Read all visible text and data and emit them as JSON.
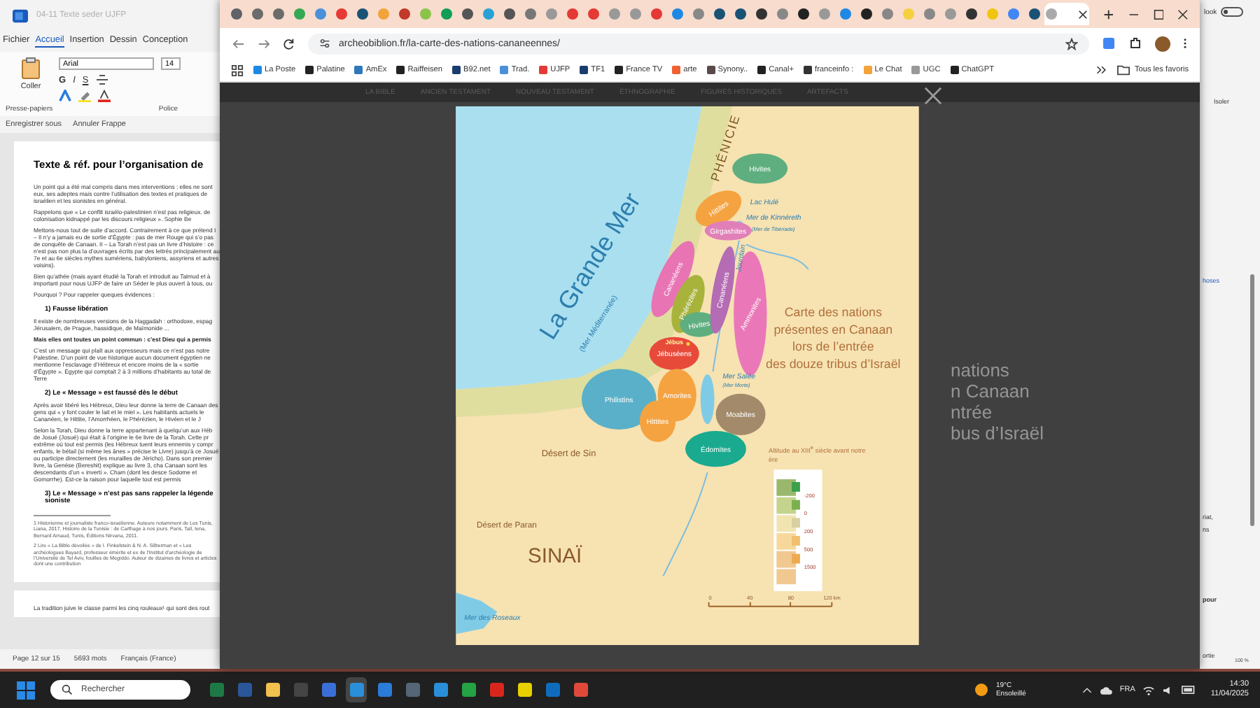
{
  "word": {
    "doc_name": "04-11 Texte seder UJFP",
    "menu": [
      {
        "label": "Fichier",
        "selected": false
      },
      {
        "label": "Accueil",
        "selected": true
      },
      {
        "label": "Insertion",
        "selected": false
      },
      {
        "label": "Dessin",
        "selected": false
      },
      {
        "label": "Conception",
        "selected": false
      }
    ],
    "paste": "Coller",
    "font": "Arial",
    "size": "14",
    "format_buttons": [
      "G",
      "I",
      "S"
    ],
    "groups": [
      "Presse-papiers",
      "Police"
    ],
    "quick": [
      "Enregistrer sous",
      "Annuler Frappe"
    ],
    "blocks": [
      {
        "kind": "title",
        "text": "Texte & réf. pour l’organisation de"
      },
      {
        "kind": "para",
        "text": "Un point qui a été mal compris dans mes interventions : elles ne sont eux, ses adeptes mais contre l’utilisation des textes et pratiques de israélien et les sionistes en général."
      },
      {
        "kind": "para",
        "text": "Rappelons que « Le conflit israélo-palestinien n’est pas religieux. de colonisation kidnappé par les discours religieux ». Sophie Be"
      },
      {
        "kind": "para",
        "text": "Mettons-nous tout de suite d’accord. Contrairement à ce que prétend I – Il n’y a jamais eu de sortie d’Égypte : pas de mer Rouge qui s’o pas de conquête de Canaan. II – La Torah n’est pas un livre d’histoire : ce n’est pas non plus la d’ouvrages écrits par des lettrés principalement au 7e et au 6e siècles mythes sumériens, babyloniens, assyriens et autres voisins)."
      },
      {
        "kind": "para",
        "text": "Bien qu’athée (mais ayant étudié la Torah et introduit au Talmud et à important pour nous UJFP de faire un Séder le plus ouvert à tous, ou"
      },
      {
        "kind": "para",
        "text": "Pourquoi ? Pour rappeler queques évidences :"
      },
      {
        "kind": "heading",
        "text": "1) Fausse libération"
      },
      {
        "kind": "para",
        "text": "Il existe de nombreuses versions de la Haggadah : orthodoxe, espag Jérusalem, de Prague, hassidique, de Maïmonide ..."
      },
      {
        "kind": "strong",
        "text": "Mais elles ont toutes un point commun : c’est Dieu qui a permis"
      },
      {
        "kind": "para",
        "text": "C’est un message qui plaît aux oppresseurs mais ce n’est pas notre Palestine. D’un point de vue historique aucun document égyptien ne mentionne l’esclavage d’Hébreux et encore moins de la « sortie d’Égypte ». Egypte qui comptait 2 à 3 millions d’habitants au total de Terre"
      },
      {
        "kind": "heading",
        "text": "2) Le « Message » est faussé dès le début"
      },
      {
        "kind": "para",
        "text": "Après avoir libéré les Hébreux, Dieu leur donne la terre de Canaan des gens qui « y font couler le lait et le miel ». Les habitants actuels le Cananéen, le Hittite, l’Amorrhéen, le Phérézien, le Hivéen et le J"
      },
      {
        "kind": "para",
        "text": "Selon la Torah, Dieu donne la terre appartenant à quelqu’un aux Héb de Josué (Josué) qui était à l’origine le 6e livre de la Torah. Cette pr extrême où tout est permis (les Hébreux tuent leurs ennemis y compr enfants, le bétail (si même les ânes » précise le Livre) jusqu’à ce Josué ou participe directement (les murailles de Jéricho). Dans son premier livre, la Genèse (Bereshit) explique au livre 3, cha Canaan sont les descendants d’un « inverti ». Cham (dont les desce Sodome et Gomorrhe). Est-ce la raison pour laquelle tout est permis"
      },
      {
        "kind": "heading",
        "text": "3) Le « Message » n’est pas sans rappeler la légende sioniste"
      },
      {
        "kind": "rule"
      },
      {
        "kind": "note",
        "text": "1 Historienne et journaliste franco-israélienne. Auteure notamment de Les Tunis, Liana, 2017, Histoire de la Tunisie : de Carthage à nos jours. Paris, Tall, Iena, Bernard Arnaud, Tunis, Éditions Nirvana, 2011."
      },
      {
        "kind": "note",
        "text": "2 Lire « La Bible dévoilée » de I. Finkelstein & N. A. Silberman et « Les archéologues Bayard, professeur émérite et ex de l’Institut d’archéologie de l’Université de Tel Aviv, fouilles de Megiddo. Auteur de dizaines de livres et articles dont une contribution"
      }
    ],
    "page2": "La tradition juive le classe parmi les cinq rouleaux¹ qui sont des rout",
    "status": [
      "Page 12 sur 15",
      "5693 mots",
      "Français (France)"
    ],
    "side": {
      "toggle_label": "look",
      "toggle_on": false,
      "isolate": "Isoler",
      "snippets": [
        "hoses",
        "riat,",
        "ns",
        "pour",
        "ortie"
      ],
      "zoom": "100 %"
    }
  },
  "browser": {
    "tabs": [
      {
        "color": "#5f6368",
        "selected": false
      },
      {
        "color": "#6b6b6b",
        "selected": false
      },
      {
        "color": "#6b6b6b",
        "selected": false
      },
      {
        "color": "#34a853",
        "selected": false
      },
      {
        "color": "#4a90d9",
        "selected": false
      },
      {
        "color": "#e53935",
        "selected": false
      },
      {
        "color": "#1a5276",
        "selected": false
      },
      {
        "color": "#f2a33a",
        "selected": false
      },
      {
        "color": "#c0392b",
        "selected": false
      },
      {
        "color": "#8bc34a",
        "selected": false
      },
      {
        "color": "#0f9d58",
        "selected": false
      },
      {
        "color": "#555555",
        "selected": false
      },
      {
        "color": "#2aa1d5",
        "selected": false
      },
      {
        "color": "#555555",
        "selected": false
      },
      {
        "color": "#777777",
        "selected": false
      },
      {
        "color": "#999999",
        "selected": false
      },
      {
        "color": "#e53935",
        "selected": false
      },
      {
        "color": "#e53935",
        "selected": false
      },
      {
        "color": "#999999",
        "selected": false
      },
      {
        "color": "#999999",
        "selected": false
      },
      {
        "color": "#e53935",
        "selected": false
      },
      {
        "color": "#1e88e5",
        "selected": false
      },
      {
        "color": "#888888",
        "selected": false
      },
      {
        "color": "#1a5276",
        "selected": false
      },
      {
        "color": "#1a5276",
        "selected": false
      },
      {
        "color": "#333333",
        "selected": false
      },
      {
        "color": "#888888",
        "selected": false
      },
      {
        "color": "#222222",
        "selected": false
      },
      {
        "color": "#999999",
        "selected": false
      },
      {
        "color": "#1e88e5",
        "selected": false
      },
      {
        "color": "#222222",
        "selected": false
      },
      {
        "color": "#888888",
        "selected": false
      },
      {
        "color": "#f4d03f",
        "selected": false
      },
      {
        "color": "#888888",
        "selected": false
      },
      {
        "color": "#999999",
        "selected": false
      },
      {
        "color": "#333333",
        "selected": false
      },
      {
        "color": "#f1c40f",
        "selected": false
      },
      {
        "color": "#4285f4",
        "selected": false
      },
      {
        "color": "#1a5276",
        "selected": false
      },
      {
        "color": "#aaaaaa",
        "selected": true
      }
    ],
    "url": "archeobiblion.fr/la-carte-des-nations-cananeennes/",
    "bookmarks": [
      {
        "label": "La Poste",
        "color": "#1e88e5"
      },
      {
        "label": "Palatine",
        "color": "#222222"
      },
      {
        "label": "AmEx",
        "color": "#2e77bb"
      },
      {
        "label": "Raiffeisen",
        "color": "#222222"
      },
      {
        "label": "B92.net",
        "color": "#1a3d6e"
      },
      {
        "label": "Trad.",
        "color": "#4a90d9"
      },
      {
        "label": "UJFP",
        "color": "#e53935"
      },
      {
        "label": "TF1",
        "color": "#1a3d6e"
      },
      {
        "label": "France TV",
        "color": "#222222"
      },
      {
        "label": "arte",
        "color": "#f06030"
      },
      {
        "label": "Synony..",
        "color": "#5a4a4a"
      },
      {
        "label": "Canal+",
        "color": "#222222"
      },
      {
        "label": "franceinfo :",
        "color": "#333333"
      },
      {
        "label": "Le Chat",
        "color": "#f2a33a"
      },
      {
        "label": "UGC",
        "color": "#999999"
      },
      {
        "label": "ChatGPT",
        "color": "#222222"
      }
    ],
    "all_bookmarks": "Tous les favoris",
    "site_nav": [
      "LA BIBLE",
      "ANCIEN TESTAMENT",
      "NOUVEAU TESTAMENT",
      "ÉTHNOGRAPHIE",
      "FIGURES HISTORIQUES",
      "ARTEFACTS"
    ],
    "behind_caption": [
      "nations",
      "n Canaan",
      "ntrée",
      "bus d’Israël"
    ]
  },
  "map": {
    "region": "PHÉNICIE",
    "sea": "La Grande Mer",
    "sea_note": "(Mer Méditerranée)",
    "peoples": [
      {
        "name": "Hivites",
        "color": "#5fae7f"
      },
      {
        "name": "Hittites",
        "color": "#f5a340"
      },
      {
        "name": "Girgashites",
        "color": "#e07fb8"
      },
      {
        "name": "Cananéens",
        "color": "#e874b4"
      },
      {
        "name": "Phérézites",
        "color": "#a8b33c"
      },
      {
        "name": "Hivites",
        "color": "#5fae7f"
      },
      {
        "name": "Cananéens",
        "color": "#b46cb4"
      },
      {
        "name": "Ammonites",
        "color": "#ea78b8"
      },
      {
        "name": "Jébuséens",
        "color": "#e84a3a"
      },
      {
        "name": "Philistins",
        "color": "#5ab0c8"
      },
      {
        "name": "Amorites",
        "color": "#f5a340"
      },
      {
        "name": "Hittites",
        "color": "#f5a340"
      },
      {
        "name": "Moabites",
        "color": "#a38a6a"
      },
      {
        "name": "Édomites",
        "color": "#1aaa8f"
      }
    ],
    "city": "Jébus",
    "waters": [
      "Lac Hulé",
      "Mer de Kinnéreth",
      "(Mer de Tibériade)",
      "Jourdain",
      "Mer Salée",
      "(Mer Morte)",
      "Mer des Roseaux"
    ],
    "deserts": [
      "Désert de Sin",
      "Désert de Paran",
      "SINAÏ"
    ],
    "title": [
      "Carte des nations",
      "présentes en Canaan",
      "lors de l’entrée",
      "des douze tribus d’Israël"
    ],
    "legend_title": "Altitude au XIII$^{e}$ siècle avant notre ère",
    "legend_values": [
      "-200",
      "0",
      "200",
      "500",
      "1500"
    ],
    "scale": [
      "0",
      "40",
      "80",
      "120 km"
    ]
  },
  "taskbar": {
    "search": "Rechercher",
    "apps": [
      {
        "color": "#1d7a45",
        "selected": false
      },
      {
        "color": "#2b579a",
        "selected": false
      },
      {
        "color": "#f2c14e",
        "selected": false
      },
      {
        "color": "#444444",
        "selected": false
      },
      {
        "color": "#3b6fd8",
        "selected": false
      },
      {
        "color": "#2a8fd8",
        "selected": true
      },
      {
        "color": "#2b7bd8",
        "selected": false
      },
      {
        "color": "#556677",
        "selected": false
      },
      {
        "color": "#2a8fd8",
        "selected": false
      },
      {
        "color": "#25a244",
        "selected": false
      },
      {
        "color": "#d9261c",
        "selected": false
      },
      {
        "color": "#e8d000",
        "selected": false
      },
      {
        "color": "#0f6cbd",
        "selected": false
      },
      {
        "color": "#e0493a",
        "selected": false
      }
    ],
    "temperature": "19°C",
    "weather": "Ensoleillé",
    "lang": "FRA",
    "time": "14:30",
    "date": "11/04/2025"
  }
}
